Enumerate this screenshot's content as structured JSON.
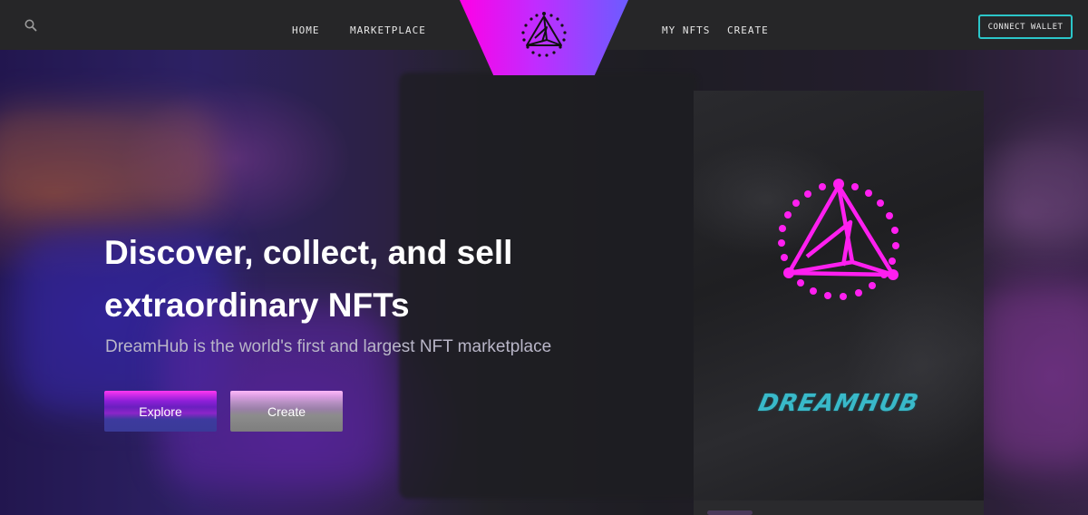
{
  "colors": {
    "accent_magenta": "#ff00e6",
    "accent_violet": "#6c5cff",
    "accent_cyan": "#2bc6c9",
    "navbar_bg": "#262628"
  },
  "navbar": {
    "search_icon": "search-icon",
    "links": [
      {
        "label": "HOME"
      },
      {
        "label": "MARKETPLACE"
      },
      {
        "label": "MY NFTS"
      },
      {
        "label": "CREATE"
      }
    ],
    "logo_icon": "dreamhub-triangle-logo",
    "connect_wallet_label": "CONNECT WALLET"
  },
  "hero": {
    "title_line1": "Discover, collect, and sell",
    "title_line2": "extraordinary NFTs",
    "subtitle": "DreamHub is the world's first and largest NFT marketplace",
    "explore_label": "Explore",
    "create_label": "Create"
  },
  "featured_card": {
    "emblem_icon": "dreamhub-triangle-logo",
    "wordmark": "DREAMHUB"
  }
}
